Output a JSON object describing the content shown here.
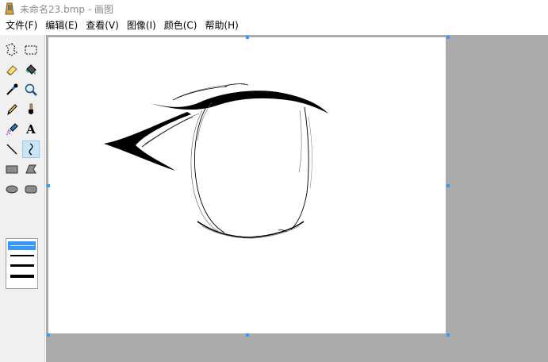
{
  "window": {
    "title": "未命名23.bmp - 画图",
    "app_icon": "paint-palette-icon"
  },
  "menu": {
    "items": [
      "文件(F)",
      "编辑(E)",
      "查看(V)",
      "图像(I)",
      "颜色(C)",
      "帮助(H)"
    ]
  },
  "toolbox": {
    "tools": [
      {
        "name": "free-form-select",
        "icon": "free-form-select-icon"
      },
      {
        "name": "rectangle-select",
        "icon": "rectangle-select-icon"
      },
      {
        "name": "eraser",
        "icon": "eraser-icon"
      },
      {
        "name": "fill",
        "icon": "fill-bucket-icon"
      },
      {
        "name": "pick-color",
        "icon": "eyedropper-icon"
      },
      {
        "name": "magnifier",
        "icon": "magnifier-icon"
      },
      {
        "name": "pencil",
        "icon": "pencil-icon"
      },
      {
        "name": "brush",
        "icon": "brush-icon"
      },
      {
        "name": "airbrush",
        "icon": "airbrush-icon"
      },
      {
        "name": "text",
        "icon": "text-icon",
        "glyph": "A"
      },
      {
        "name": "line",
        "icon": "line-icon"
      },
      {
        "name": "curve",
        "icon": "curve-icon",
        "selected": true
      },
      {
        "name": "rectangle",
        "icon": "rectangle-icon"
      },
      {
        "name": "polygon",
        "icon": "polygon-icon"
      },
      {
        "name": "ellipse",
        "icon": "ellipse-icon"
      },
      {
        "name": "rounded-rectangle",
        "icon": "rounded-rectangle-icon"
      }
    ],
    "line_widths": {
      "options": 4,
      "selected": 1
    }
  },
  "colors": {
    "selection": "#3399ff",
    "selected_tool": "#cce4f7",
    "workspace": "#ababab",
    "toolbox": "#f0f0f0",
    "ink": "#000000"
  }
}
